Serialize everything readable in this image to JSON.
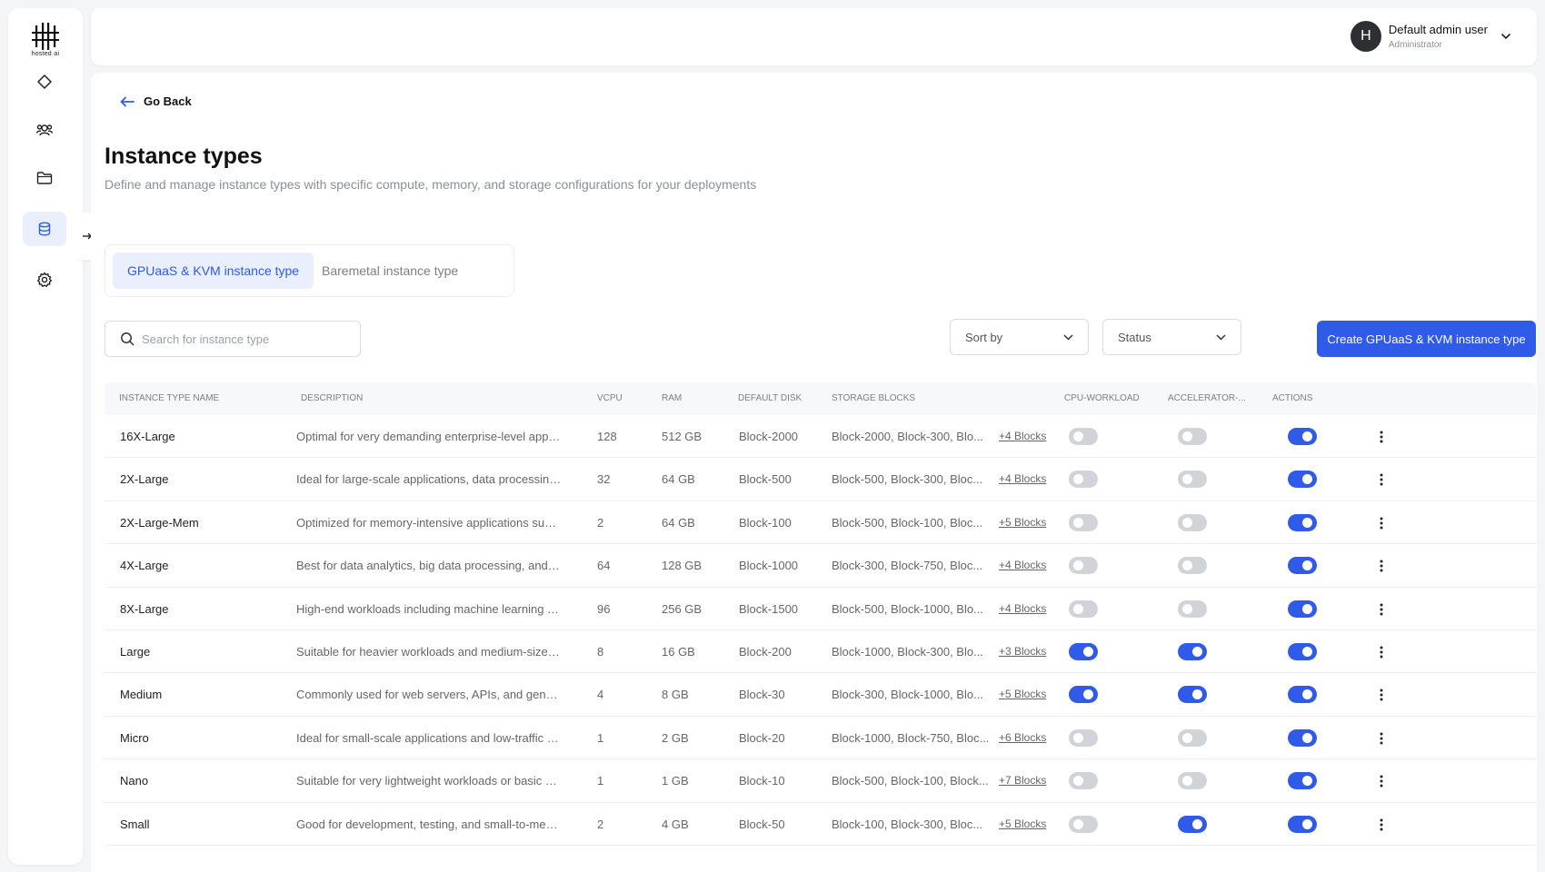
{
  "brand": {
    "logo_text": "hosted·ai"
  },
  "sidebar": {
    "items": [
      {
        "name": "diamond-icon"
      },
      {
        "name": "users-icon"
      },
      {
        "name": "folder-icon"
      },
      {
        "name": "layers-icon",
        "active": true
      },
      {
        "name": "gear-icon"
      }
    ]
  },
  "header": {
    "avatar_initial": "H",
    "user_name": "Default admin user",
    "user_role": "Administrator"
  },
  "page": {
    "back_label": "Go Back",
    "title": "Instance types",
    "subtitle": "Define and manage instance types with specific compute, memory, and storage configurations for your deployments"
  },
  "tabs": [
    {
      "label": "GPUaaS & KVM instance type",
      "active": true
    },
    {
      "label": "Baremetal instance type",
      "active": false
    }
  ],
  "toolbar": {
    "search_placeholder": "Search for instance type",
    "sort_label": "Sort by",
    "status_label": "Status",
    "create_label": "Create GPUaaS & KVM instance type"
  },
  "table": {
    "columns": [
      "Instance type name",
      "Description",
      "vCPU",
      "RAM",
      "Default disk",
      "Storage blocks",
      "CPU-Workload",
      "Accelerator-...",
      "Actions"
    ],
    "rows": [
      {
        "name": "16X-Large",
        "description": "Optimal for very demanding enterprise-level applicat...",
        "vcpu": "128",
        "ram": "512 GB",
        "disk": "Block-2000",
        "blocks": "Block-2000, Block-300, Blo...",
        "more": "+4 Blocks",
        "cpu": false,
        "acc": false,
        "act": true
      },
      {
        "name": "2X-Large",
        "description": "Ideal for large-scale applications, data processing, a...",
        "vcpu": "32",
        "ram": "64 GB",
        "disk": "Block-500",
        "blocks": "Block-500, Block-300, Bloc...",
        "more": "+4 Blocks",
        "cpu": false,
        "acc": false,
        "act": true
      },
      {
        "name": "2X-Large-Mem",
        "description": "Optimized for memory-intensive applications such as...",
        "vcpu": "2",
        "ram": "64 GB",
        "disk": "Block-100",
        "blocks": "Block-500, Block-100, Bloc...",
        "more": "+5 Blocks",
        "cpu": false,
        "acc": false,
        "act": true
      },
      {
        "name": "4X-Large",
        "description": "Best for data analytics, big data processing, and high...",
        "vcpu": "64",
        "ram": "128 GB",
        "disk": "Block-1000",
        "blocks": "Block-300, Block-750, Bloc...",
        "more": "+4 Blocks",
        "cpu": false,
        "acc": false,
        "act": true
      },
      {
        "name": "8X-Large",
        "description": "High-end workloads including machine learning and l...",
        "vcpu": "96",
        "ram": "256 GB",
        "disk": "Block-1500",
        "blocks": "Block-500, Block-1000, Blo...",
        "more": "+4 Blocks",
        "cpu": false,
        "acc": false,
        "act": true
      },
      {
        "name": "Large",
        "description": "Suitable for heavier workloads and medium-sized dat...",
        "vcpu": "8",
        "ram": "16 GB",
        "disk": "Block-200",
        "blocks": "Block-1000, Block-300, Blo...",
        "more": "+3 Blocks",
        "cpu": true,
        "acc": true,
        "act": true
      },
      {
        "name": "Medium",
        "description": "Commonly used for web servers, APIs, and general-pu...",
        "vcpu": "4",
        "ram": "8 GB",
        "disk": "Block-30",
        "blocks": "Block-300, Block-1000, Blo...",
        "more": "+5 Blocks",
        "cpu": true,
        "acc": true,
        "act": true
      },
      {
        "name": "Micro",
        "description": "Ideal for small-scale applications and low-traffic web...",
        "vcpu": "1",
        "ram": "2 GB",
        "disk": "Block-20",
        "blocks": "Block-1000, Block-750, Bloc...",
        "more": "+6 Blocks",
        "cpu": false,
        "acc": false,
        "act": true
      },
      {
        "name": "Nano",
        "description": "Suitable for very lightweight workloads or basic servic...",
        "vcpu": "1",
        "ram": "1 GB",
        "disk": "Block-10",
        "blocks": "Block-500, Block-100, Block...",
        "more": "+7 Blocks",
        "cpu": false,
        "acc": false,
        "act": true
      },
      {
        "name": "Small",
        "description": "Good for development, testing, and small-to-mediu...",
        "vcpu": "2",
        "ram": "4 GB",
        "disk": "Block-50",
        "blocks": "Block-100, Block-300, Bloc...",
        "more": "+5 Blocks",
        "cpu": false,
        "acc": true,
        "act": true
      }
    ]
  },
  "colors": {
    "accent": "#2f5be8",
    "toggle_off": "#d0d3d8",
    "tab_active_bg": "#e9effd"
  }
}
